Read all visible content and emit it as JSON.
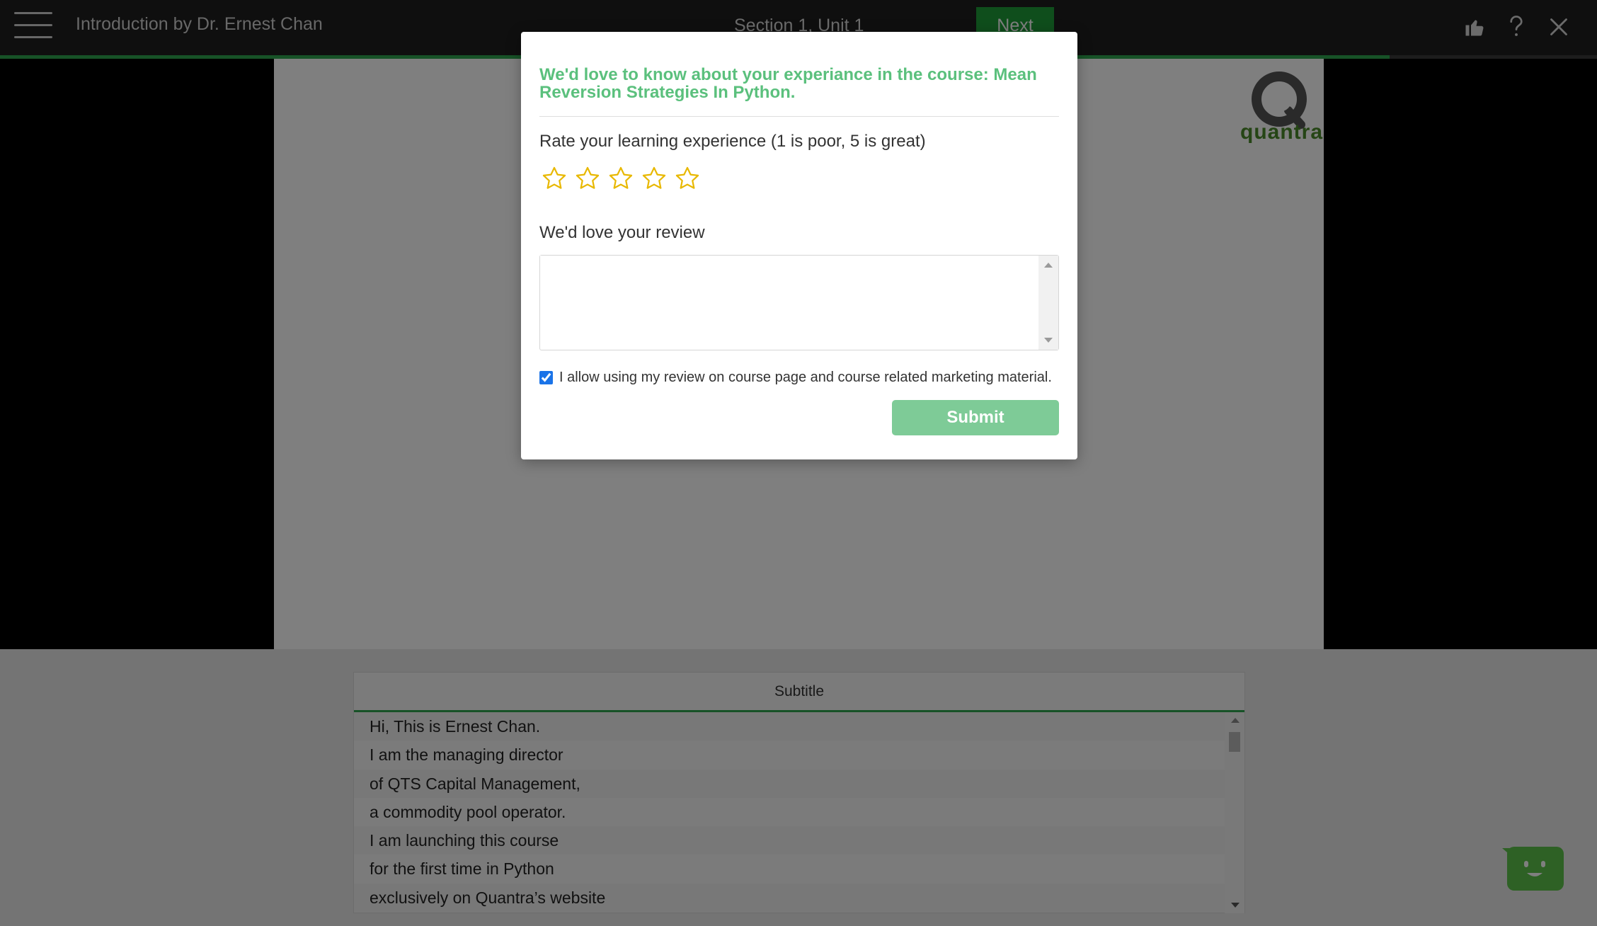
{
  "header": {
    "lesson_title": "Introduction by Dr. Ernest Chan",
    "section_label": "Section 1, Unit 1",
    "next_label": "Next",
    "progress_fraction": 0.87,
    "icons": [
      "menu-icon",
      "thumbs-up-icon",
      "help-icon",
      "close-icon"
    ]
  },
  "video": {
    "logo_text": "quantra"
  },
  "subtitles": {
    "header": "Subtitle",
    "lines": [
      "Hi, This is Ernest Chan.",
      "I am the managing director",
      "of QTS Capital Management,",
      "a commodity pool operator.",
      "I am launching this course",
      "for the first time in Python",
      "exclusively on Quantra’s website"
    ]
  },
  "modal": {
    "title": "We'd love to know about your experiance in the course: Mean Reversion Strategies In Python.",
    "rate_label": "Rate your learning experience (1 is poor, 5 is great)",
    "rating_selected": 0,
    "rating_max": 5,
    "review_label": "We'd love your review",
    "review_value": "",
    "consent_checked": true,
    "consent_text": "I allow using my review on course page and course related marketing material.",
    "submit_label": "Submit"
  },
  "colors": {
    "accent_green": "#5bc07d",
    "button_green": "#1f9c39",
    "star_outline": "#e8b800",
    "chatbot_green": "#5cc24a"
  }
}
